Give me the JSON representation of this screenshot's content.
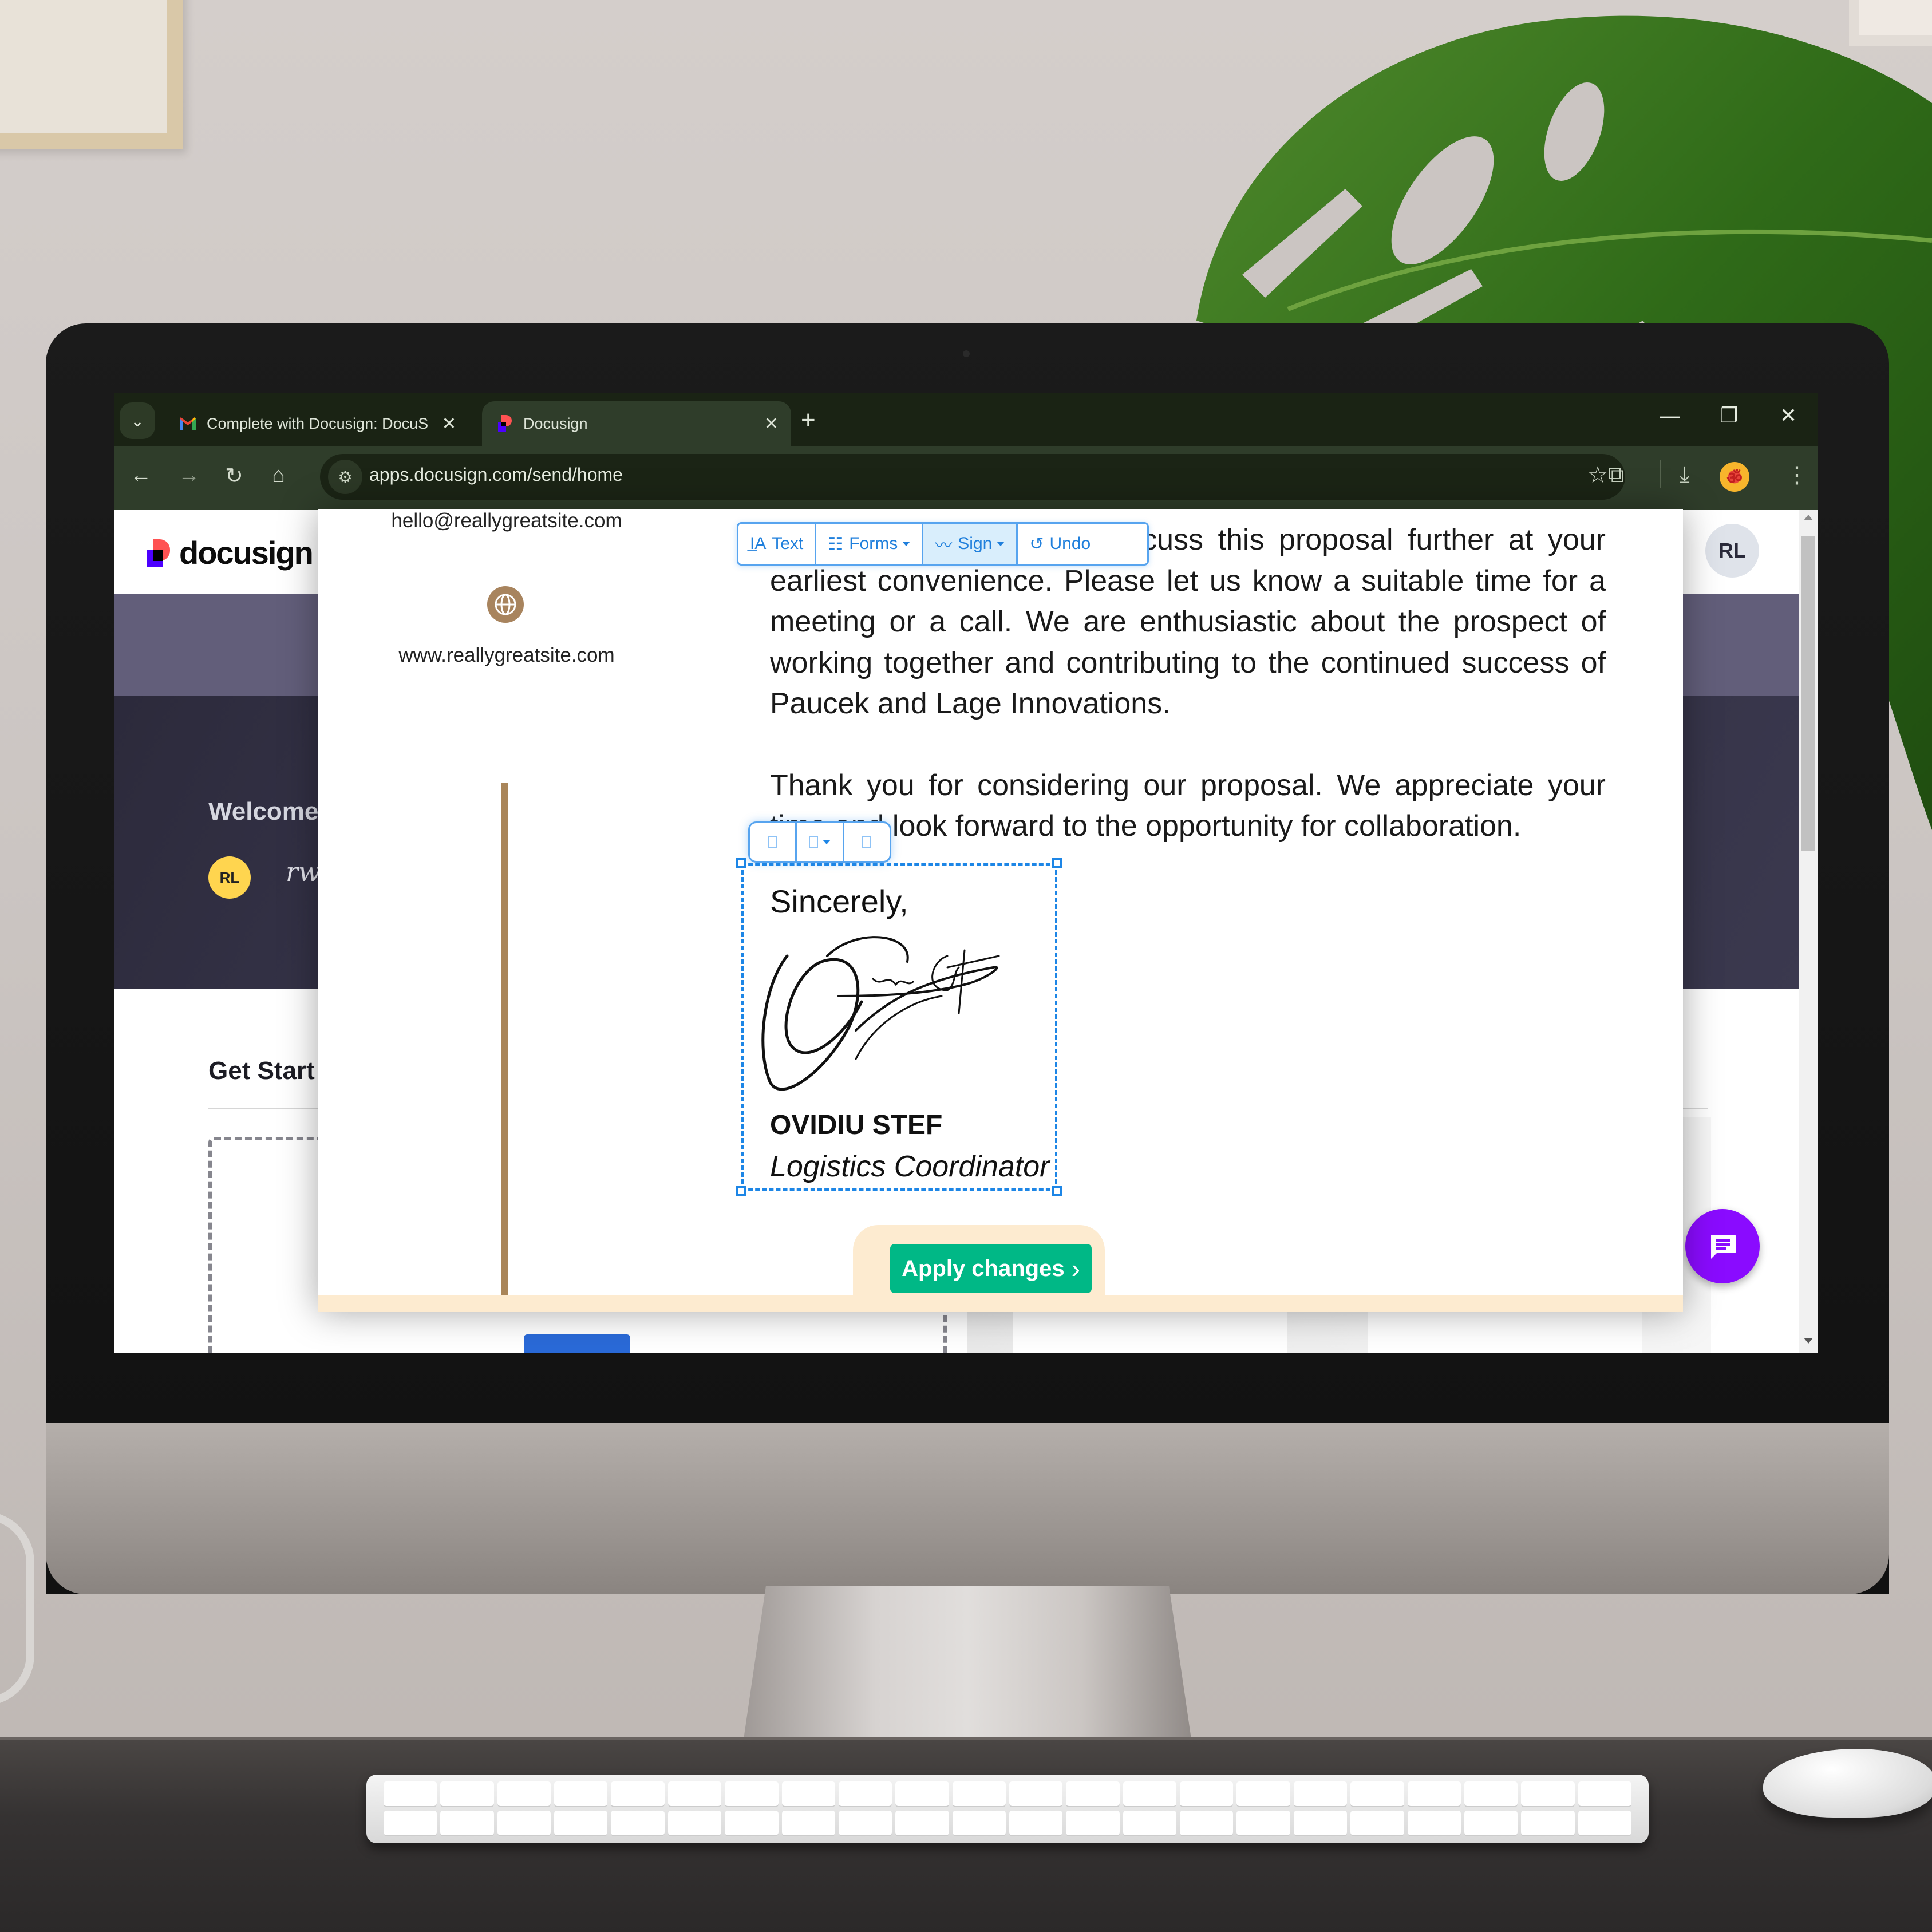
{
  "browser": {
    "tabs": [
      {
        "title": "Complete with Docusign: DocuS",
        "favicon": "gmail-icon",
        "active": false
      },
      {
        "title": "Docusign",
        "favicon": "docusign-icon",
        "active": true
      }
    ],
    "new_tab_label": "+",
    "url": "apps.docusign.com/send/home",
    "window_controls": {
      "minimize": "—",
      "restore": "❐",
      "close": "✕"
    }
  },
  "app": {
    "logo_text": "docusign",
    "user_initials": "RL",
    "welcome_text": "Welcome",
    "welcome_sig": "rw",
    "get_started": "Get Start",
    "colors": {
      "accent_purple": "#8a0bff",
      "apply_green": "#00b886",
      "selection_blue": "#1d86e6",
      "band": "#625e7a",
      "hero": "#2c2a3b",
      "avatar_yellow": "#ffd54f"
    }
  },
  "document": {
    "contact_email": "hello@reallygreatsite.com",
    "contact_web": "www.reallygreatsite.com",
    "paragraphs": [
      "We would be happy to discuss this proposal further at your earliest convenience. Please let us know a suitable time for a meeting or a call. We are enthusiastic about the prospect of working together and contributing to the continued success of Paucek and Lage Innovations.",
      "Thank you for considering our proposal. We appreciate your time and look forward to the opportunity for collaboration."
    ],
    "closing": "Sincerely,",
    "signer_name": "OVIDIU STEF",
    "signer_title": "Logistics Coordinator"
  },
  "editor_toolbar": {
    "text_label": "Text",
    "forms_label": "Forms",
    "sign_label": "Sign",
    "undo_label": "Undo",
    "active": "Sign"
  },
  "apply_button_label": "Apply changes",
  "apply_chevron": "›"
}
